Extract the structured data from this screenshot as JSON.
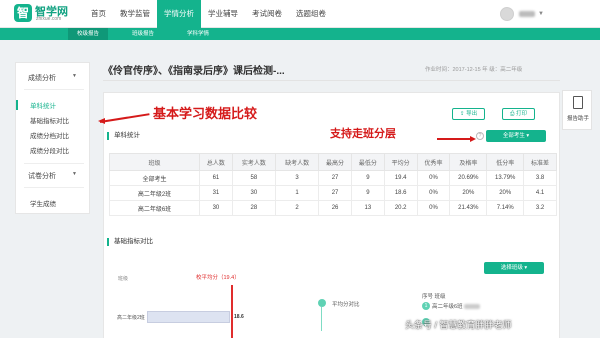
{
  "logo": {
    "name": "智学网",
    "sub": "zhixue.com",
    "mark": "智"
  },
  "nav": {
    "items": [
      "首页",
      "教学监管",
      "学情分析",
      "学业辅导",
      "考试阅卷",
      "选题组卷"
    ],
    "active": "学情分析"
  },
  "subnav": {
    "items": [
      "校级报告",
      "班级报告",
      "学科学情"
    ],
    "active": "校级报告"
  },
  "sidebar": {
    "group1": "成绩分析",
    "items": [
      "单科统计",
      "基础指标对比",
      "成绩分档对比",
      "成绩分段对比"
    ],
    "active": "单科统计",
    "group2": "试卷分析",
    "group3": "学生成绩"
  },
  "exam": {
    "title": "《伶官传序》、《指南录后序》课后检测-...",
    "meta": "作业时间：2017-12-15    年 级：高二年级"
  },
  "buttons": {
    "export": "导出",
    "print": "打印",
    "all_students": "全部考生",
    "select_class": "选择班级"
  },
  "section1": {
    "title": "单科统计"
  },
  "table": {
    "headers": [
      "班级",
      "总人数",
      "实考人数",
      "缺考人数",
      "最高分",
      "最低分",
      "平均分",
      "优秀率",
      "及格率",
      "低分率",
      "标准差"
    ],
    "rows": [
      [
        "全部考生",
        "61",
        "58",
        "3",
        "27",
        "9",
        "19.4",
        "0%",
        "20.69%",
        "13.79%",
        "3.8"
      ],
      [
        "高二年级2班",
        "31",
        "30",
        "1",
        "27",
        "9",
        "18.6",
        "0%",
        "20%",
        "20%",
        "4.1"
      ],
      [
        "高二年级6班",
        "30",
        "28",
        "2",
        "26",
        "13",
        "20.2",
        "0%",
        "21.43%",
        "7.14%",
        "3.2"
      ]
    ]
  },
  "section2": {
    "title": "基础指标对比"
  },
  "chart": {
    "axis_label": "班级",
    "avg_label": "校平均分（19.4）",
    "bar_class": "高二年级2班",
    "bar_value": "18.6",
    "compare_label": "平均分对比",
    "legend_header": "序号  班级",
    "legend_item": "高二年级6班"
  },
  "annotations": {
    "a1": "基本学习数据比较",
    "a2": "支持走班分层"
  },
  "assist": {
    "label": "报告助手"
  },
  "watermark": "头条号 / 智慧教育胖胖老师",
  "colors": {
    "brand": "#14b38d",
    "annotation": "#d51a1a"
  }
}
